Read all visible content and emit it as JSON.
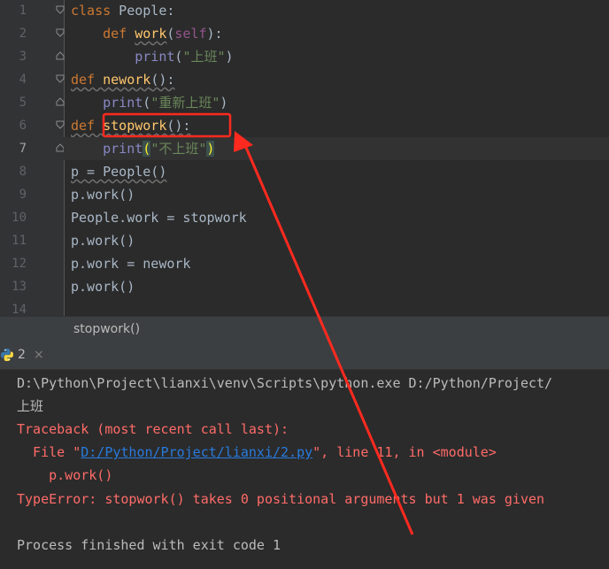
{
  "editor": {
    "line_numbers": [
      "1",
      "2",
      "3",
      "4",
      "5",
      "6",
      "7",
      "8",
      "9",
      "10",
      "11",
      "12",
      "13",
      "14"
    ],
    "current_line": "7",
    "lines": [
      {
        "t": "class",
        "s": " People:"
      },
      {
        "i": "    ",
        "kw": "def",
        "sp": " ",
        "fn": "work",
        "p1": "(",
        "self": "self",
        "p2": "):"
      },
      {
        "i": "        ",
        "bi": "print",
        "p1": "(",
        "str": "\"上班\"",
        "p2": ")"
      },
      {
        "kw": "def",
        "sp": " ",
        "fn": "nework",
        "p": "():"
      },
      {
        "i": "    ",
        "bi": "print",
        "p1": "(",
        "str": "\"重新上班\"",
        "p2": ")"
      },
      {
        "kw": "def",
        "sp": " ",
        "fn": "stopwork",
        "p": "():"
      },
      {
        "i": "    ",
        "bi": "print",
        "p1": "(",
        "str": "\"不上班\"",
        "p2": ")"
      },
      {
        "text": "p = People()"
      },
      {
        "text": "p.work()"
      },
      {
        "text": "People.work = stopwork"
      },
      {
        "text": "p.work()"
      },
      {
        "text": "p.work = nework"
      },
      {
        "text": "p.work()"
      }
    ]
  },
  "breadcrumb": {
    "text": "stopwork()"
  },
  "run_panel": {
    "tab_label": "2",
    "close": "×"
  },
  "console": {
    "cmd": "D:\\Python\\Project\\lianxi\\venv\\Scripts\\python.exe D:/Python/Project/",
    "out1": "上班",
    "tb_header": "Traceback (most recent call last):",
    "tb_file_pre": "  File \"",
    "tb_file_link": "D:/Python/Project/lianxi/2.py",
    "tb_file_post": "\", line 11, in <module>",
    "tb_code": "    p.work()",
    "error": "TypeError: stopwork() takes 0 positional arguments but 1 was given",
    "finished": "Process finished with exit code 1"
  },
  "colors": {
    "annotation": "#ff2a1f",
    "error": "#ff6b68",
    "link": "#287bde",
    "keyword": "#cc7832",
    "function": "#ffc66d",
    "string": "#6a8759"
  }
}
